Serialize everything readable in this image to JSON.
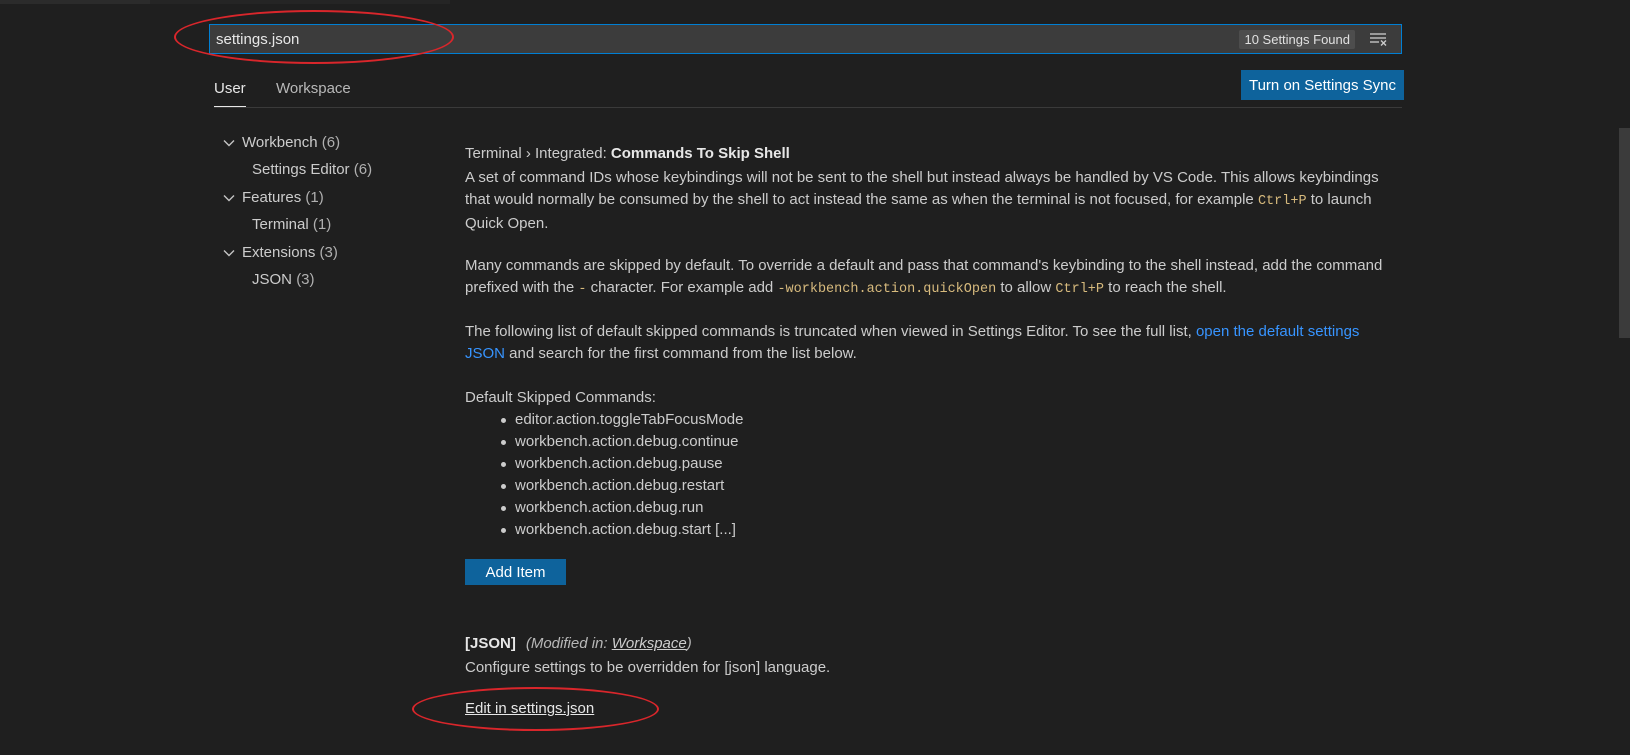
{
  "search": {
    "value": "settings.json",
    "results_badge": "10 Settings Found",
    "clear_icon": "clear-filter-icon"
  },
  "tabs": [
    {
      "label": "User",
      "active": true
    },
    {
      "label": "Workspace",
      "active": false
    }
  ],
  "sync_button": "Turn on Settings Sync",
  "tree": [
    {
      "label": "Workbench",
      "count": "(6)",
      "level": 0
    },
    {
      "label": "Settings Editor",
      "count": "(6)",
      "level": 1
    },
    {
      "label": "Features",
      "count": "(1)",
      "level": 0
    },
    {
      "label": "Terminal",
      "count": "(1)",
      "level": 1
    },
    {
      "label": "Extensions",
      "count": "(3)",
      "level": 0
    },
    {
      "label": "JSON",
      "count": "(3)",
      "level": 1
    }
  ],
  "setting": {
    "category": "Terminal › Integrated: ",
    "name": "Commands To Skip Shell",
    "p1_a": "A set of command IDs whose keybindings will not be sent to the shell but instead always be handled by VS Code. This allows keybindings that would normally be consumed by the shell to act instead the same as when the terminal is not focused, for example ",
    "p1_code": "Ctrl+P",
    "p1_b": " to launch Quick Open.",
    "p2_a": "Many commands are skipped by default. To override a default and pass that command's keybinding to the shell instead, add the command prefixed with the ",
    "p2_code1": "-",
    "p2_b": " character. For example add ",
    "p2_code2": "-workbench.action.quickOpen",
    "p2_c": " to allow ",
    "p2_code3": "Ctrl+P",
    "p2_d": " to reach the shell.",
    "p3_a": "The following list of default skipped commands is truncated when viewed in Settings Editor. To see the full list, ",
    "p3_link": "open the default settings JSON",
    "p3_b": " and search for the first command from the list below.",
    "list_title": "Default Skipped Commands:",
    "commands": [
      "editor.action.toggleTabFocusMode",
      "workbench.action.debug.continue",
      "workbench.action.debug.pause",
      "workbench.action.debug.restart",
      "workbench.action.debug.run",
      "workbench.action.debug.start [...]"
    ],
    "add_item": "Add Item"
  },
  "json_setting": {
    "name": "[JSON]",
    "modified_prefix": "(Modified in: ",
    "modified_link": "Workspace",
    "modified_suffix": ")",
    "description": "Configure settings to be overridden for [json] language.",
    "edit_link": "Edit in settings.json"
  },
  "colors": {
    "background": "#1f1f1f",
    "accent_button": "#0e639c",
    "link": "#3794ff",
    "code": "#d7ba7d",
    "annotation": "#d9262b"
  }
}
